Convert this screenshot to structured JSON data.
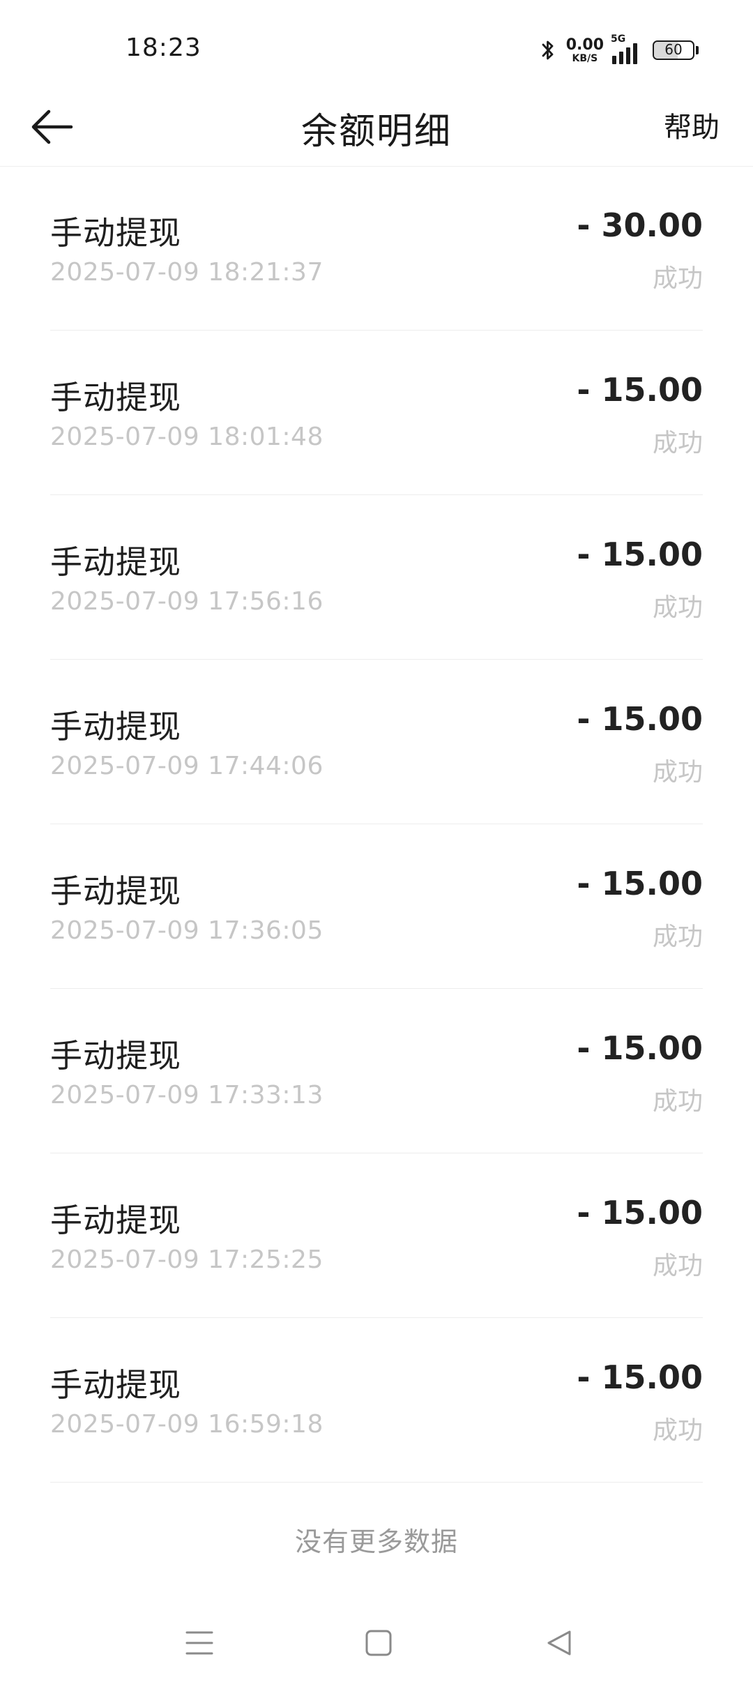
{
  "status_bar": {
    "time": "18:23",
    "net_speed_value": "0.00",
    "net_speed_unit": "KB/S",
    "network_type": "5G",
    "battery_level": "60",
    "battery_fraction": 0.6,
    "icons": [
      "bluetooth-icon",
      "signal-icon",
      "battery-icon"
    ]
  },
  "header": {
    "back_icon": "arrow-left-icon",
    "title": "余额明细",
    "help_label": "帮助"
  },
  "transactions": [
    {
      "title": "手动提现",
      "time": "2025-07-09 18:21:37",
      "amount": "- 30.00",
      "status": "成功"
    },
    {
      "title": "手动提现",
      "time": "2025-07-09 18:01:48",
      "amount": "- 15.00",
      "status": "成功"
    },
    {
      "title": "手动提现",
      "time": "2025-07-09 17:56:16",
      "amount": "- 15.00",
      "status": "成功"
    },
    {
      "title": "手动提现",
      "time": "2025-07-09 17:44:06",
      "amount": "- 15.00",
      "status": "成功"
    },
    {
      "title": "手动提现",
      "time": "2025-07-09 17:36:05",
      "amount": "- 15.00",
      "status": "成功"
    },
    {
      "title": "手动提现",
      "time": "2025-07-09 17:33:13",
      "amount": "- 15.00",
      "status": "成功"
    },
    {
      "title": "手动提现",
      "time": "2025-07-09 17:25:25",
      "amount": "- 15.00",
      "status": "成功"
    },
    {
      "title": "手动提现",
      "time": "2025-07-09 16:59:18",
      "amount": "- 15.00",
      "status": "成功"
    }
  ],
  "footer": {
    "no_more_text": "没有更多数据"
  },
  "nav_bar": {
    "icons": [
      "menu-icon",
      "home-square-icon",
      "back-triangle-icon"
    ]
  },
  "colors": {
    "text_primary": "#1f1f1f",
    "text_secondary": "#c6c6c6",
    "divider": "#ededed",
    "background": "#ffffff"
  }
}
